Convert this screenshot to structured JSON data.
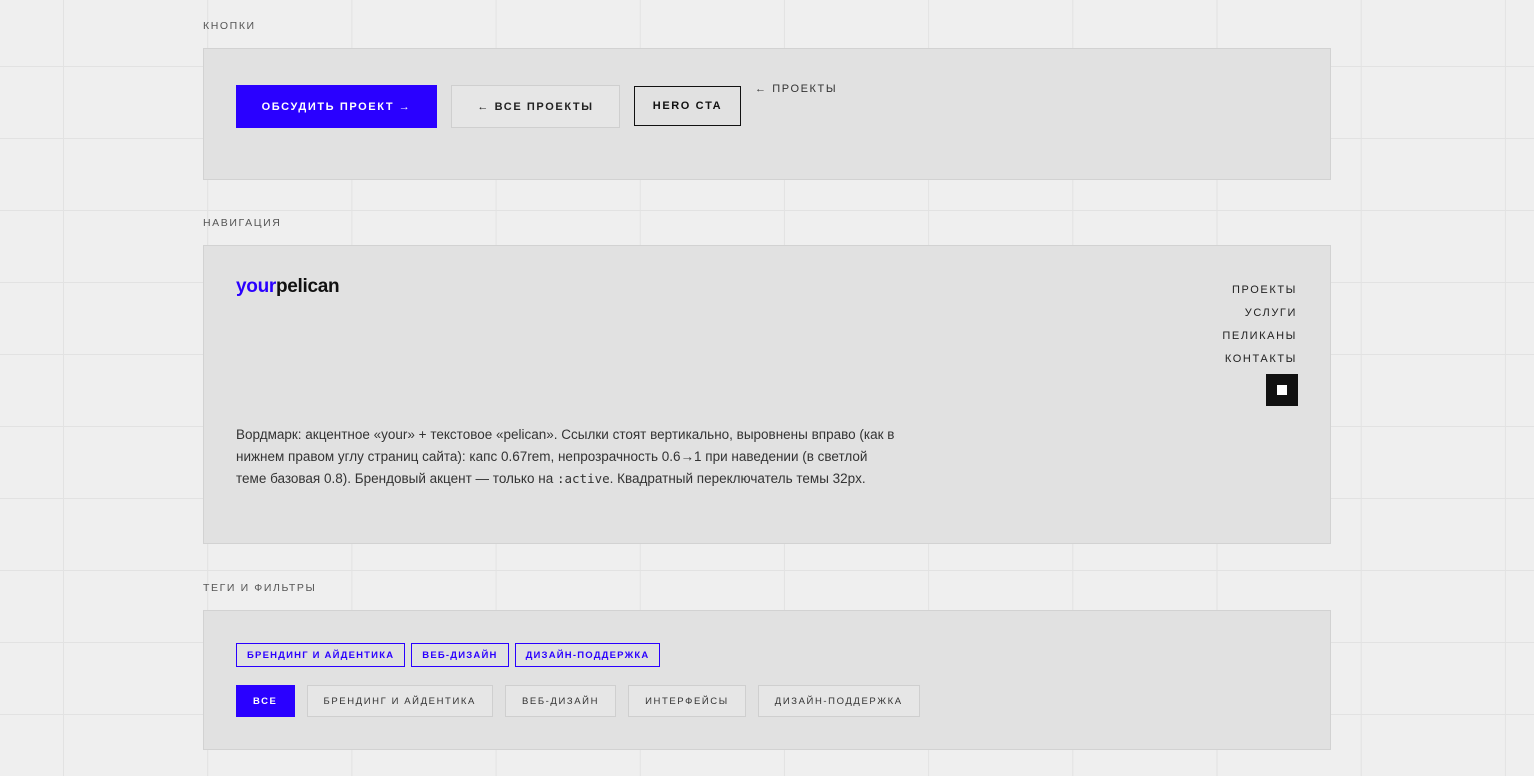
{
  "colors": {
    "accent": "#2a00ff",
    "panel": "#e1e1e1",
    "background": "#efefef",
    "ink": "#111111"
  },
  "sections": {
    "buttons": {
      "label": "КНОПКИ",
      "primary": "ОБСУДИТЬ ПРОЕКТ →",
      "secondary": "← ВСЕ ПРОЕКТЫ",
      "outline": "HERO CTA",
      "link": "← ПРОЕКТЫ"
    },
    "navigation": {
      "label": "НАВИГАЦИЯ",
      "wordmark_accent": "your",
      "wordmark_text": "pelican",
      "links": [
        "ПРОЕКТЫ",
        "УСЛУГИ",
        "ПЕЛИКАНЫ",
        "КОНТАКТЫ"
      ],
      "theme_toggle_icon": "square-icon",
      "description_part1": "Вордмарк: акцентное «your» + текстовое «pelican». Ссылки стоят вертикально, выровнены вправо (как в нижнем правом углу страниц сайта): капс 0.67rem, непрозрачность 0.6→1 при наведении (в светлой теме базовая 0.8). Брендовый акцент — только на ",
      "description_code": ":active",
      "description_part2": ". Квадратный переключатель темы 32px."
    },
    "tags": {
      "label": "ТЕГИ И ФИЛЬТРЫ",
      "tag_items": [
        "БРЕНДИНГ И АЙДЕНТИКА",
        "ВЕБ-ДИЗАЙН",
        "ДИЗАЙН-ПОДДЕРЖКА"
      ],
      "filters": [
        "ВСЕ",
        "БРЕНДИНГ И АЙДЕНТИКА",
        "ВЕБ-ДИЗАЙН",
        "ИНТЕРФЕЙСЫ",
        "ДИЗАЙН-ПОДДЕРЖКА"
      ],
      "active_filter": "ВСЕ"
    }
  }
}
